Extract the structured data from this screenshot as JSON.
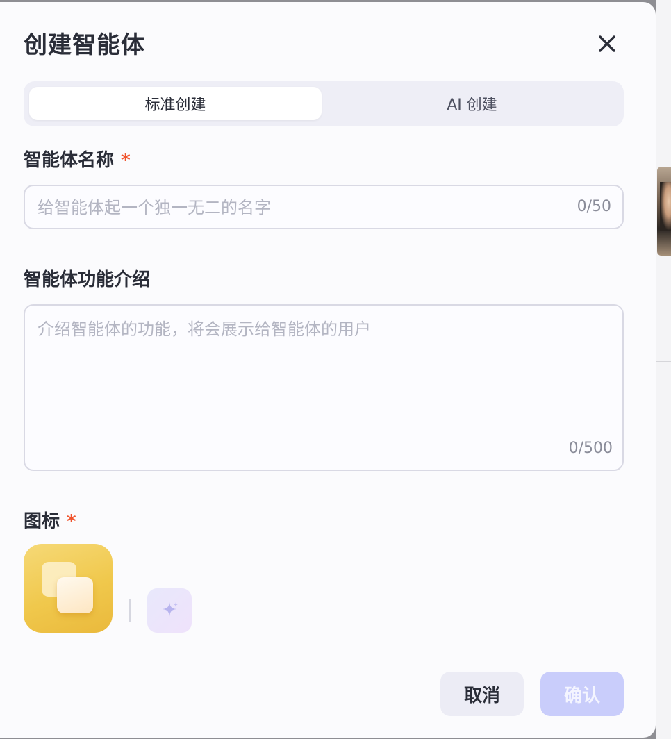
{
  "dialog": {
    "title": "创建智能体",
    "close_icon": "close-icon"
  },
  "tabs": [
    {
      "label": "标准创建",
      "active": true
    },
    {
      "label": "AI 创建",
      "active": false
    }
  ],
  "name_field": {
    "label": "智能体名称",
    "required_mark": "*",
    "value": "",
    "placeholder": "给智能体起一个独一无二的名字",
    "counter": "0/50"
  },
  "description_field": {
    "label": "智能体功能介绍",
    "value": "",
    "placeholder": "介绍智能体的功能，将会展示给智能体的用户",
    "counter": "0/500"
  },
  "icon_field": {
    "label": "图标",
    "required_mark": "*",
    "selected_icon": "stacked-squares-icon",
    "ai_generate_icon": "sparkle-icon"
  },
  "footer": {
    "cancel_label": "取消",
    "confirm_label": "确认"
  },
  "colors": {
    "required": "#f0532c",
    "confirm_disabled": "#c9cdfb",
    "icon_yellow": "#f0c84c"
  }
}
